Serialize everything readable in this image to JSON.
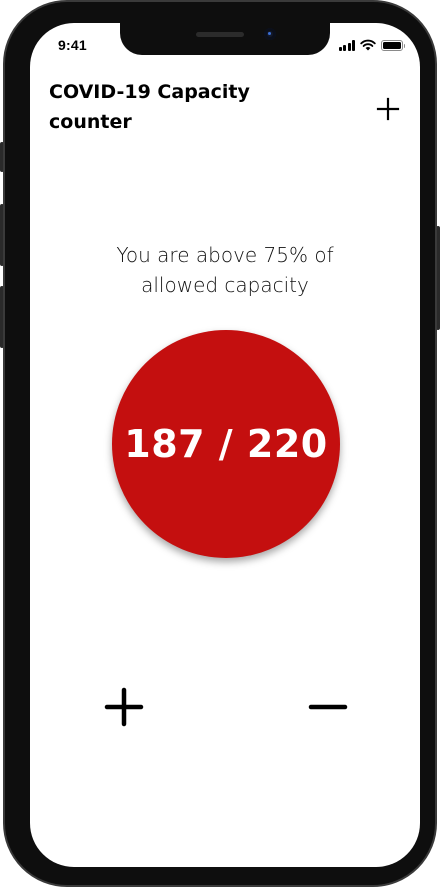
{
  "status_bar": {
    "time": "9:41"
  },
  "header": {
    "title": "COVID-19 Capacity counter",
    "add_icon": "plus-icon"
  },
  "capacity": {
    "message": "You are above 75% of allowed capacity",
    "current": 187,
    "max": 220,
    "display": "187 / 220",
    "alert_color": "#c40f0f"
  },
  "controls": {
    "increment_icon": "plus-icon",
    "decrement_icon": "minus-icon"
  }
}
